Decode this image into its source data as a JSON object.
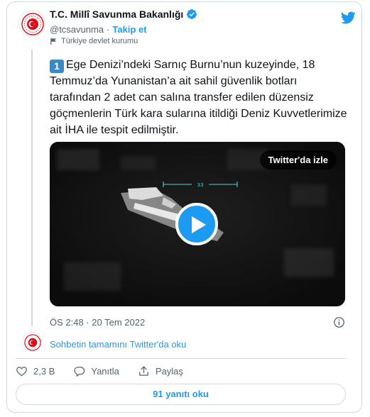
{
  "author": {
    "name": "T.C. Millî Savunma Bakanlığı",
    "handle": "@tcsavunma",
    "separator": "·",
    "follow_label": "Takip et",
    "account_label": "Türkiye devlet kurumu"
  },
  "tweet": {
    "keycap": "1",
    "text": "Ege Denizi’ndeki Sarnıç Burnu’nun kuzeyinde, 18 Temmuz’da Yunanistan’a ait sahil güvenlik botları tarafından 2 adet can salına transfer edilen düzensiz göçmenlerin Türk kara sularına itildiği Deniz Kuvvetlerimize ait İHA ile tespit edilmiştir.",
    "timestamp": "ÖS 2:48 · 20 Tem 2022"
  },
  "media": {
    "watch_label": "Twitter'da izle",
    "overlay_number": "33"
  },
  "thread_link": "Sohbetin tamamını Twitter'da oku",
  "actions": {
    "like_count": "2,3 B",
    "reply_label": "Yanıtla",
    "share_label": "Paylaş"
  },
  "replies_button": "91 yanıtı oku",
  "colors": {
    "accent": "#1d9bf0",
    "text": "#0f1419",
    "muted": "#536471",
    "border": "#cfd9de",
    "keycap": "#3b88c3",
    "seal_red": "#e30a17"
  },
  "icons": [
    "verified-badge-icon",
    "twitter-bird-icon",
    "flag-icon",
    "play-icon",
    "info-icon",
    "heart-icon",
    "reply-icon",
    "share-icon"
  ]
}
